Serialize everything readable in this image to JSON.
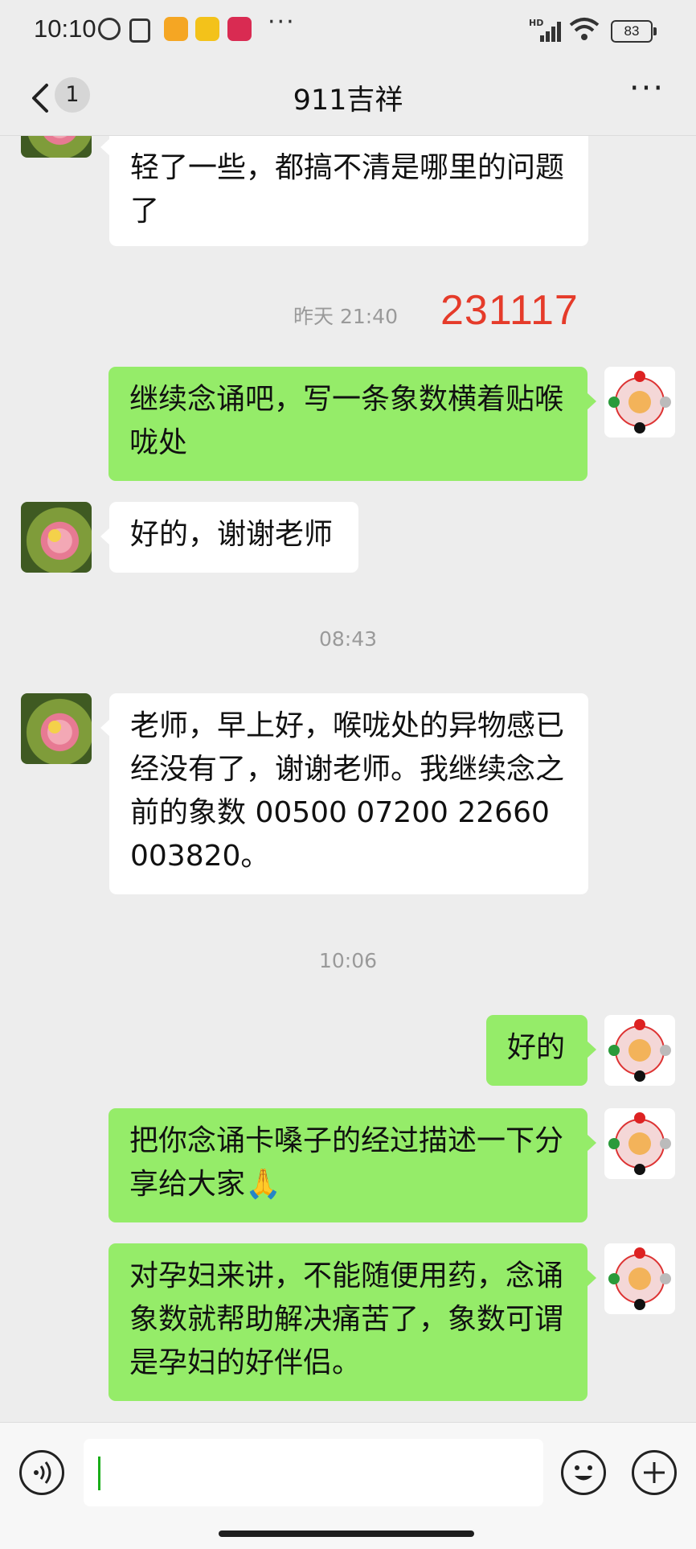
{
  "status": {
    "time": "10:10",
    "battery": "83",
    "hd": "HD"
  },
  "nav": {
    "unread": "1",
    "title": "911吉祥"
  },
  "messages": [
    {
      "side": "in",
      "text": "轻了一些，都搞不清是哪里的问题了"
    },
    {
      "side": "stamp",
      "text": "昨天 21:40"
    },
    {
      "side": "annotation",
      "text": "231117"
    },
    {
      "side": "out",
      "text": "继续念诵吧，写一条象数横着贴喉咙处"
    },
    {
      "side": "in",
      "text": "好的，谢谢老师"
    },
    {
      "side": "stamp",
      "text": "08:43"
    },
    {
      "side": "in",
      "text": "老师，早上好，喉咙处的异物感已经没有了，谢谢老师。我继续念之前的象数 00500  07200  22660 003820。"
    },
    {
      "side": "stamp",
      "text": "10:06"
    },
    {
      "side": "out",
      "text": "好的"
    },
    {
      "side": "out",
      "text": "把你念诵卡嗓子的经过描述一下分享给大家🙏"
    },
    {
      "side": "out",
      "text": "对孕妇来讲，不能随便用药，念诵象数就帮助解决痛苦了，象数可谓是孕妇的好伴侣。"
    }
  ],
  "colors": {
    "outgoing": "#95ec69",
    "incoming": "#ffffff",
    "annotation": "#e53b2a",
    "background": "#ededed"
  },
  "icons": {
    "back": "chevron-left-icon",
    "more": "more-dots-icon",
    "voice": "voice-icon",
    "emoji": "emoji-icon",
    "plus": "plus-icon"
  }
}
